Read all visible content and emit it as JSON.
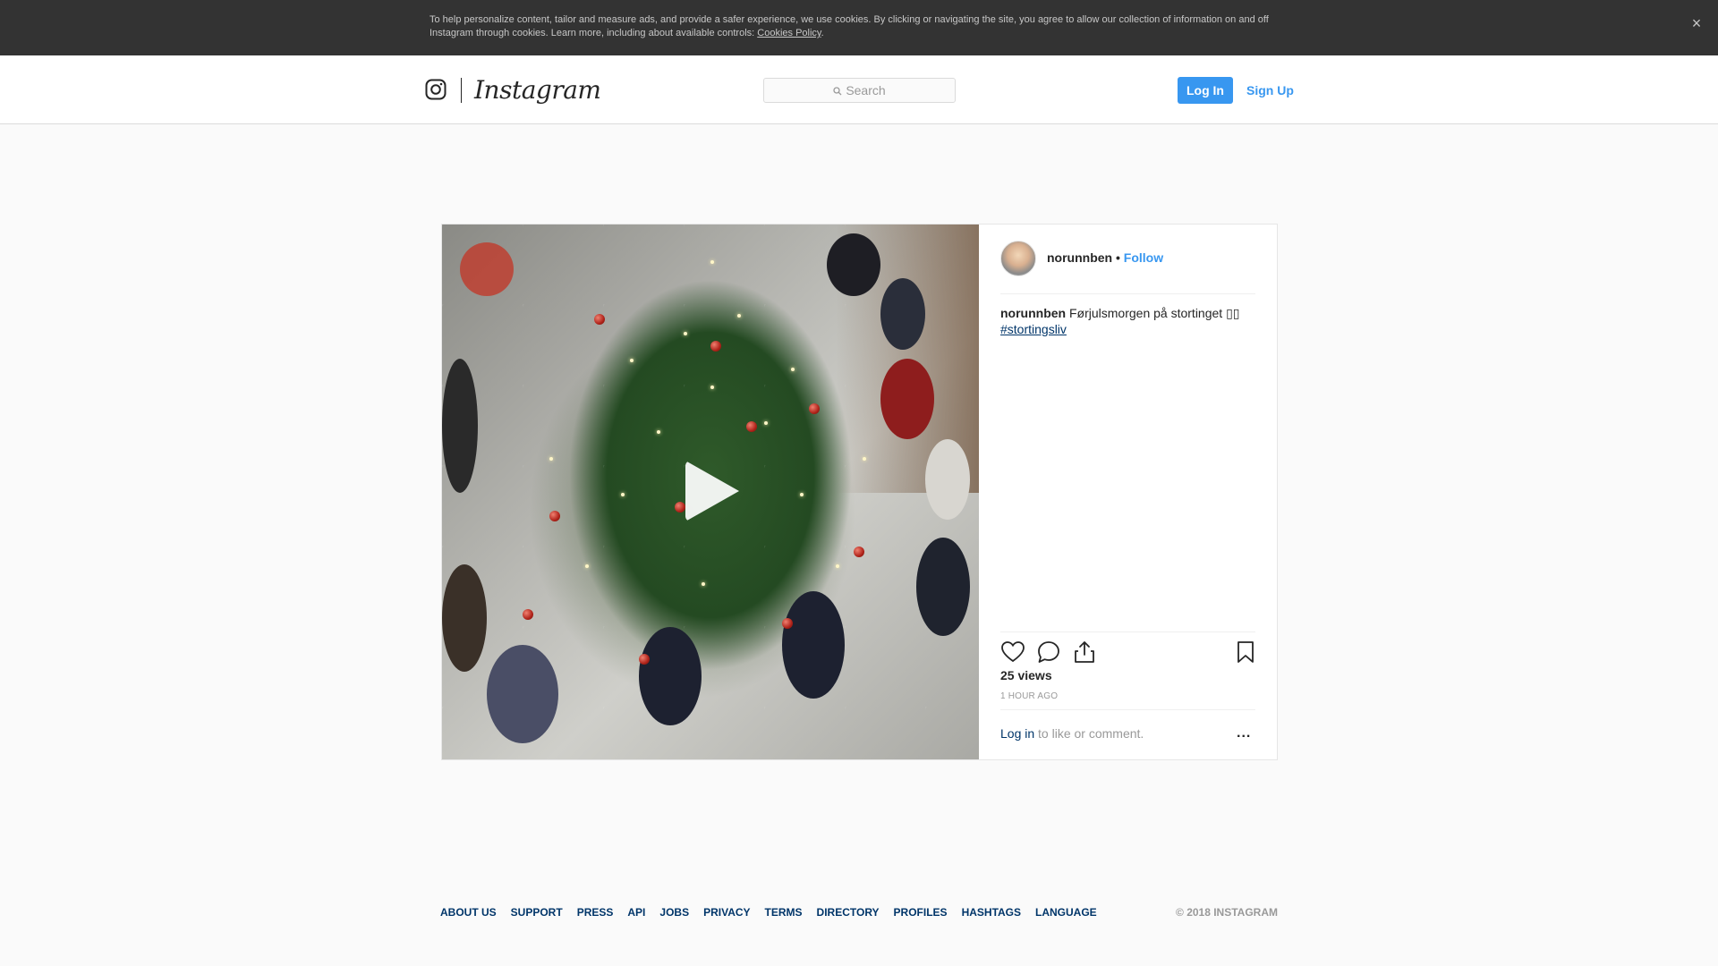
{
  "cookie_banner": {
    "text": "To help personalize content, tailor and measure ads, and provide a safer experience, we use cookies. By clicking or navigating the site, you agree to allow our collection of information on and off Instagram through cookies. Learn more, including about available controls: ",
    "link": "Cookies Policy",
    "period": ".",
    "close": "×"
  },
  "header": {
    "logo_text": "Instagram",
    "search_placeholder": "Search",
    "login_label": "Log In",
    "signup_label": "Sign Up"
  },
  "post": {
    "username": "norunnben",
    "separator": "•",
    "follow_label": "Follow",
    "caption_user": "norunnben",
    "caption_text": "Førjulsmorgen på stortinget ▯▯",
    "hashtag": "#stortingsliv",
    "views": "25 views",
    "time_ago": "1 HOUR AGO",
    "login_link": "Log in",
    "login_suffix": " to like or comment.",
    "more": "..."
  },
  "footer": {
    "links": [
      "ABOUT US",
      "SUPPORT",
      "PRESS",
      "API",
      "JOBS",
      "PRIVACY",
      "TERMS",
      "DIRECTORY",
      "PROFILES",
      "HASHTAGS",
      "LANGUAGE"
    ],
    "copyright": "© 2018 INSTAGRAM"
  },
  "colors": {
    "accent": "#3897f0",
    "link": "#003569",
    "banner": "#333333"
  },
  "icons": [
    "instagram-glyph-icon",
    "search-icon",
    "close-icon",
    "play-icon",
    "heart-icon",
    "comment-icon",
    "share-icon",
    "bookmark-icon",
    "more-icon"
  ]
}
